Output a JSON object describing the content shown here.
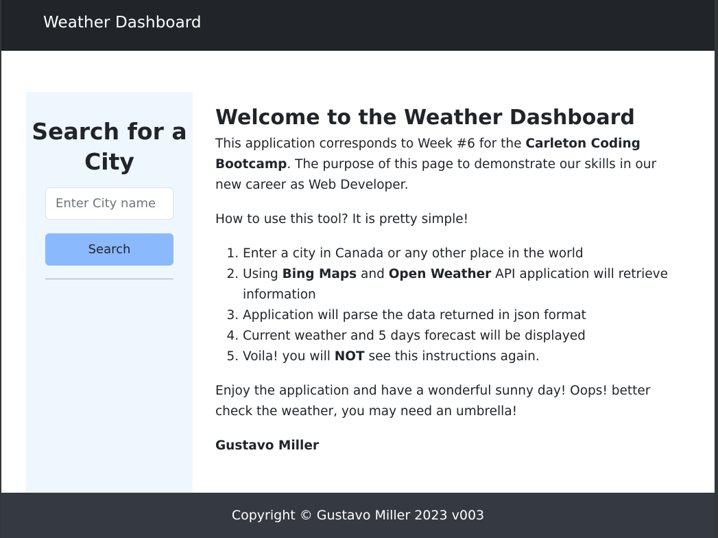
{
  "navbar": {
    "brand": "Weather Dashboard"
  },
  "sidebar": {
    "title": "Search for a City",
    "search_input": {
      "placeholder": "Enter City name",
      "value": ""
    },
    "search_button_label": "Search"
  },
  "main": {
    "heading": "Welcome to the Weather Dashboard",
    "intro": {
      "text_1": "This application corresponds to Week #6 for the ",
      "bold_1": "Carleton Coding Bootcamp",
      "text_2": ". The purpose of this page to demonstrate our skills in our new career as Web Developer."
    },
    "howto": "How to use this tool? It is pretty simple!",
    "steps": [
      {
        "text": "Enter a city in Canada or any other place in the world"
      },
      {
        "pre": "Using ",
        "bold_a": "Bing Maps",
        "mid": " and ",
        "bold_b": "Open Weather",
        "post": " API application will retrieve information"
      },
      {
        "text": "Application will parse the data returned in json format"
      },
      {
        "text": "Current weather and 5 days forecast will be displayed"
      },
      {
        "pre": "Voila! you will ",
        "bold": "NOT",
        "post": " see this instructions again."
      }
    ],
    "closing": "Enjoy the application and have a wonderful sunny day! Oops! better check the weather, you may need an umbrella!",
    "signature": "Gustavo Miller"
  },
  "footer": {
    "text": "Copyright © Gustavo Miller 2023 v003"
  },
  "colors": {
    "navbar_bg": "#212529",
    "sidebar_bg": "#eef6fe",
    "button_bg": "#8bb9fe",
    "footer_bg": "#343a40"
  }
}
